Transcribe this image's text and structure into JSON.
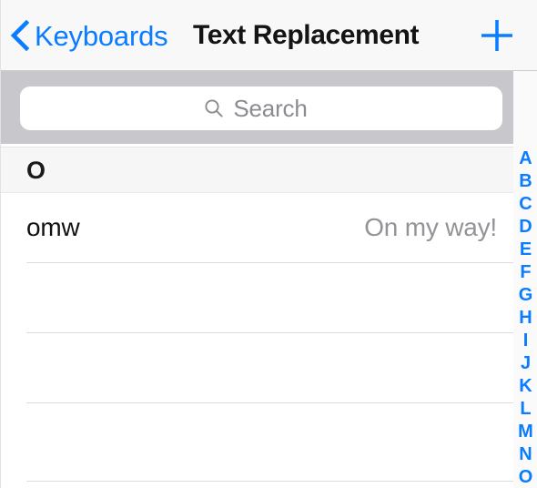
{
  "navbar": {
    "back_label": "Keyboards",
    "back_icon": "chevron-left-icon",
    "title": "Text Replacement",
    "add_icon": "plus-icon",
    "accent_color": "#0a7cff",
    "title_color": "#141414",
    "background_color": "#f8f8f8"
  },
  "search": {
    "placeholder": "Search",
    "value": "",
    "icon": "search-icon",
    "band_color": "#c8c7cc",
    "field_color": "#ffffff",
    "placeholder_color": "#8c8c90"
  },
  "list": {
    "sections": [
      {
        "header": "O",
        "rows": [
          {
            "shortcut": "omw",
            "phrase": "On my way!"
          },
          {
            "shortcut": "",
            "phrase": ""
          },
          {
            "shortcut": "",
            "phrase": ""
          },
          {
            "shortcut": "",
            "phrase": ""
          }
        ]
      }
    ],
    "header_background": "#f6f6f6",
    "separator_color": "#dcdcde",
    "shortcut_color": "#111111",
    "phrase_color": "#949498"
  },
  "section_index": {
    "letters": [
      "A",
      "B",
      "C",
      "D",
      "E",
      "F",
      "G",
      "H",
      "I",
      "J",
      "K",
      "L",
      "M",
      "N",
      "O"
    ],
    "color": "#0a7cff"
  }
}
